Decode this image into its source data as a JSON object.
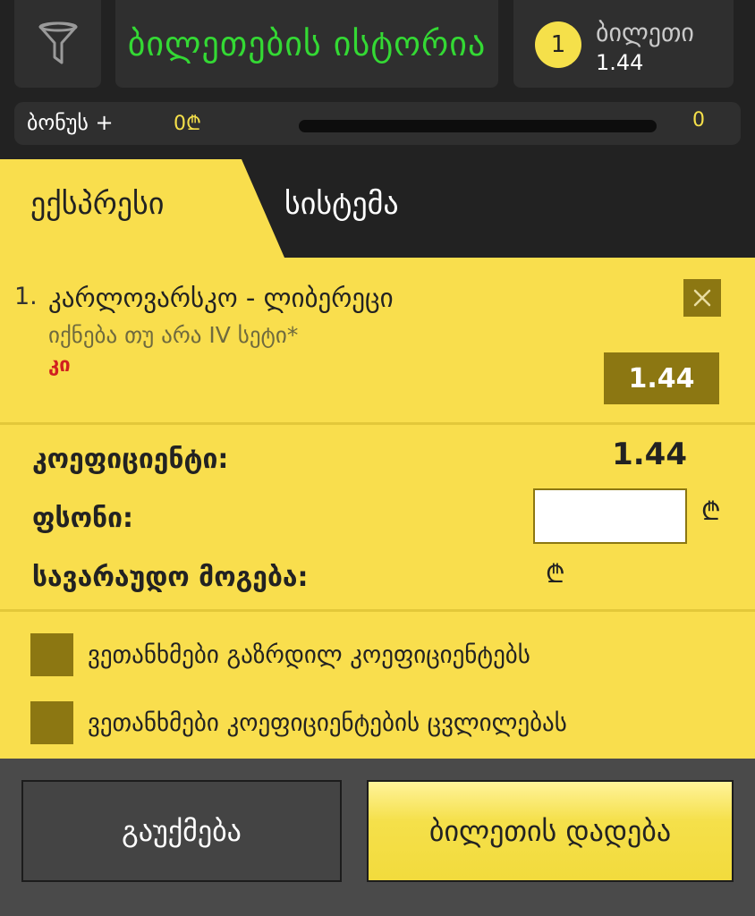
{
  "header": {
    "filter_icon": "funnel-icon",
    "history_label": "ბილეთების ისტორია",
    "ticket_count": "1",
    "ticket_label": "ბილეთი",
    "ticket_odd": "1.44"
  },
  "bonus": {
    "label": "ბონუს +",
    "amount": "0₾",
    "progress": 0,
    "count": "0"
  },
  "tabs": [
    {
      "label": "ექსპრესი",
      "active": true
    },
    {
      "label": "სისტემა",
      "active": false
    }
  ],
  "bet": {
    "number": "1.",
    "match": "კარლოვარსკო - ლიბერეცი",
    "market": "იქნება თუ არა IV სეტი*",
    "pick": "კი",
    "odd": "1.44",
    "close_icon": "close-icon"
  },
  "summary": {
    "coef_label": "კოეფიციენტი:",
    "coef_value": "1.44",
    "stake_label": "ფსონი:",
    "stake_value": "",
    "win_label": "სავარაუდო მოგება:",
    "currency": "₾"
  },
  "checks": [
    {
      "label": "ვეთანხმები გაზრდილ კოეფიციენტებს",
      "checked": false
    },
    {
      "label": "ვეთანხმები კოეფიციენტების ცვლილებას",
      "checked": false
    }
  ],
  "footer": {
    "cancel_label": "გაუქმება",
    "place_label": "ბილეთის დადება"
  },
  "colors": {
    "accent": "#f9de4d",
    "dark": "#222222",
    "green": "#34d934",
    "olive": "#8c7712",
    "red": "#d02020"
  }
}
